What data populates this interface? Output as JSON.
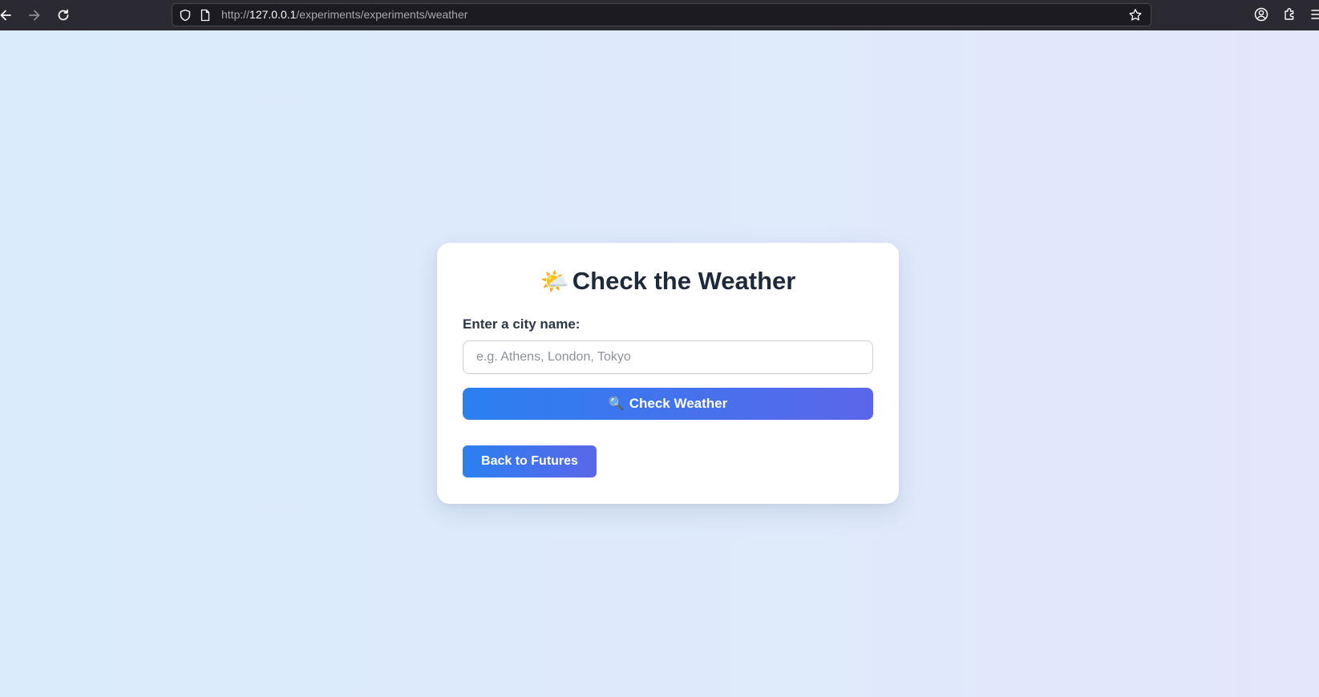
{
  "browser": {
    "url_prefix": "http://",
    "url_host": "127.0.0.1",
    "url_path": "/experiments/experiments/weather",
    "icons": {
      "back": "arrow-left-icon",
      "forward": "arrow-right-icon",
      "reload": "reload-icon",
      "shield": "shield-icon",
      "page": "page-icon",
      "bookmark": "star-icon",
      "account": "account-icon",
      "extensions": "extensions-icon",
      "menu": "menu-icon"
    }
  },
  "weather_card": {
    "title_emoji": "🌤️",
    "title": "Check the Weather",
    "city_label": "Enter a city name:",
    "city_input": {
      "value": "",
      "placeholder": "e.g. Athens, London, Tokyo"
    },
    "check_button_icon": "🔍",
    "check_button_label": "Check Weather",
    "back_button_label": "Back to Futures"
  },
  "colors": {
    "button_gradient_start": "#2a80f0",
    "button_gradient_end": "#5b66ea",
    "title_color": "#1e2a3b",
    "page_background": "#dcebfb"
  }
}
